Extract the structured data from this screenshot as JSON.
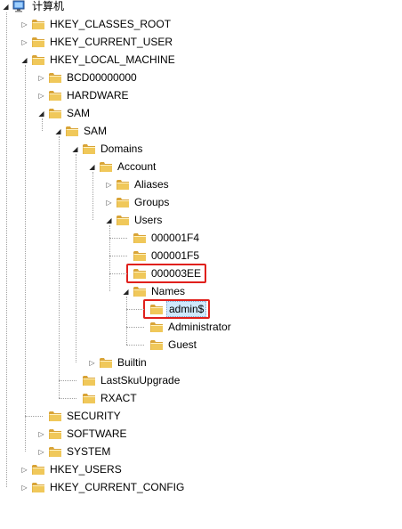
{
  "tree": {
    "root": {
      "label": "计算机",
      "icon": "computer-icon"
    },
    "nodes": [
      {
        "id": "hkcr",
        "label": "HKEY_CLASSES_ROOT",
        "level": 1,
        "state": "collapsed"
      },
      {
        "id": "hkcu",
        "label": "HKEY_CURRENT_USER",
        "level": 1,
        "state": "collapsed"
      },
      {
        "id": "hklm",
        "label": "HKEY_LOCAL_MACHINE",
        "level": 1,
        "state": "expanded"
      },
      {
        "id": "bcd",
        "label": "BCD00000000",
        "level": 2,
        "state": "collapsed"
      },
      {
        "id": "hardware",
        "label": "HARDWARE",
        "level": 2,
        "state": "collapsed"
      },
      {
        "id": "sam1",
        "label": "SAM",
        "level": 2,
        "state": "expanded"
      },
      {
        "id": "sam2",
        "label": "SAM",
        "level": 3,
        "state": "expanded"
      },
      {
        "id": "domains",
        "label": "Domains",
        "level": 4,
        "state": "expanded"
      },
      {
        "id": "account",
        "label": "Account",
        "level": 5,
        "state": "expanded"
      },
      {
        "id": "aliases",
        "label": "Aliases",
        "level": 6,
        "state": "collapsed"
      },
      {
        "id": "groups",
        "label": "Groups",
        "level": 6,
        "state": "collapsed"
      },
      {
        "id": "users",
        "label": "Users",
        "level": 6,
        "state": "expanded"
      },
      {
        "id": "u1f4",
        "label": "000001F4",
        "level": 7,
        "state": "leaf"
      },
      {
        "id": "u1f5",
        "label": "000001F5",
        "level": 7,
        "state": "leaf"
      },
      {
        "id": "u3ee",
        "label": "000003EE",
        "level": 7,
        "state": "leaf",
        "highlighted": true
      },
      {
        "id": "names",
        "label": "Names",
        "level": 7,
        "state": "expanded"
      },
      {
        "id": "admin",
        "label": "admin$",
        "level": 8,
        "state": "leaf",
        "selected": true,
        "highlighted": true
      },
      {
        "id": "administrator",
        "label": "Administrator",
        "level": 8,
        "state": "leaf"
      },
      {
        "id": "guest",
        "label": "Guest",
        "level": 8,
        "state": "leaf"
      },
      {
        "id": "builtin",
        "label": "Builtin",
        "level": 5,
        "state": "collapsed"
      },
      {
        "id": "lastsku",
        "label": "LastSkuUpgrade",
        "level": 4,
        "state": "leaf"
      },
      {
        "id": "rxact",
        "label": "RXACT",
        "level": 4,
        "state": "leaf"
      },
      {
        "id": "security",
        "label": "SECURITY",
        "level": 2,
        "state": "leaf"
      },
      {
        "id": "software",
        "label": "SOFTWARE",
        "level": 2,
        "state": "collapsed"
      },
      {
        "id": "system",
        "label": "SYSTEM",
        "level": 2,
        "state": "collapsed"
      },
      {
        "id": "hku",
        "label": "HKEY_USERS",
        "level": 1,
        "state": "collapsed"
      },
      {
        "id": "hkcc",
        "label": "HKEY_CURRENT_CONFIG",
        "level": 1,
        "state": "collapsed"
      }
    ]
  },
  "colors": {
    "highlight_box": "#e0201c",
    "selection_bg": "#cfe8fc",
    "folder_fill": "#f0c85a",
    "folder_dark": "#d9a437"
  }
}
